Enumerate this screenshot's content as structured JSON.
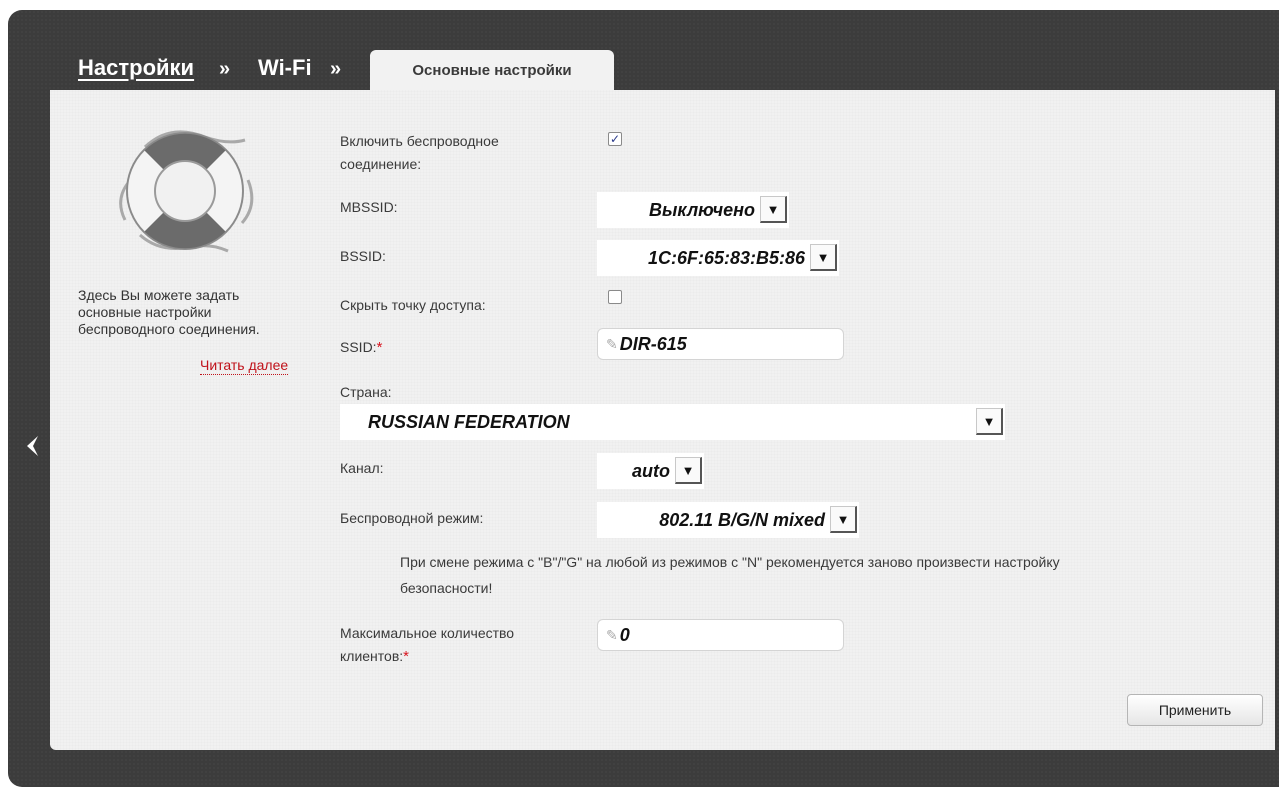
{
  "breadcrumb": {
    "settings": "Настройки",
    "sep1": "»",
    "wifi": "Wi-Fi",
    "sep2": "»",
    "active_tab": "Основные настройки"
  },
  "sidebar": {
    "icon": "lifebuoy-icon",
    "help_text": "Здесь Вы можете задать основные настройки беспроводного соединения.",
    "read_more": "Читать далее"
  },
  "form": {
    "enable_wireless": {
      "label_line1": "Включить беспроводное",
      "label_line2": "соединение:",
      "checked": true,
      "check_mark": "✓"
    },
    "mbssid": {
      "label": "MBSSID:",
      "value": "Выключено"
    },
    "bssid": {
      "label": "BSSID:",
      "value": "1C:6F:65:83:B5:86"
    },
    "hide_ap": {
      "label": "Скрыть точку доступа:",
      "checked": false
    },
    "ssid": {
      "label": "SSID:",
      "required_mark": "*",
      "value": "DIR-615"
    },
    "country": {
      "label": "Страна:",
      "value": "RUSSIAN FEDERATION"
    },
    "channel": {
      "label": "Канал:",
      "value": "auto"
    },
    "wireless_mode": {
      "label": "Беспроводной режим:",
      "value": "802.11 B/G/N mixed"
    },
    "mode_note_line1": "При смене режима с \"B\"/\"G\" на любой из режимов с \"N\" рекомендуется заново произвести настройку",
    "mode_note_line2": "безопасности!",
    "max_clients": {
      "label_line1": "Максимальное количество",
      "label_line2": "клиентов:",
      "required_mark": "*",
      "value": "0"
    }
  },
  "actions": {
    "apply": "Применить"
  },
  "icons": {
    "dropdown": "▼",
    "pencil": "✎",
    "back": "chevron-left-icon"
  },
  "colors": {
    "frame": "#3c3c3c",
    "panel": "#f1f1f1",
    "required": "#d8141e",
    "link": "#c0121a"
  }
}
